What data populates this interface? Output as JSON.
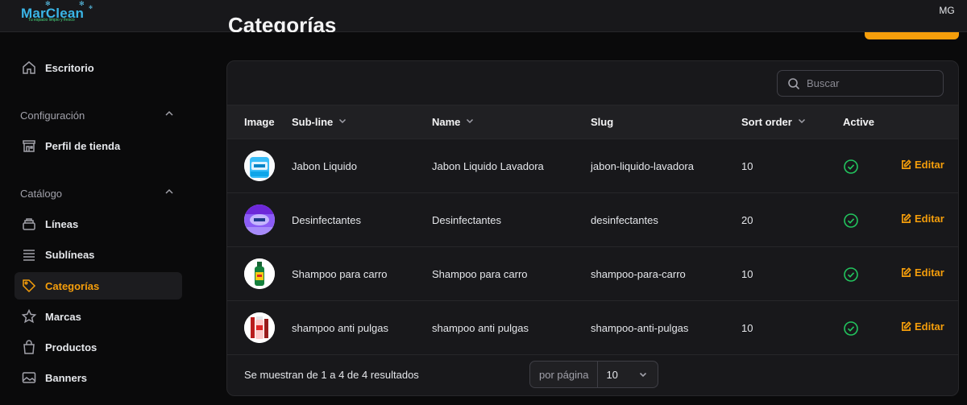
{
  "app": {
    "logo_text": "MarClean",
    "logo_tagline": "Tu espacio limpio y fresco",
    "user_initials": "MG"
  },
  "header": {
    "page_title": "Categorías"
  },
  "colors": {
    "accent": "#f59e0b",
    "active_check": "#22c55e",
    "logo": "#3ab5e6"
  },
  "sidebar": {
    "dashboard": {
      "label": "Escritorio",
      "icon": "home-icon"
    },
    "groups": [
      {
        "label": "Configuración",
        "items": [
          {
            "label": "Perfil de tienda",
            "icon": "store-icon"
          }
        ]
      },
      {
        "label": "Catálogo",
        "items": [
          {
            "label": "Líneas",
            "icon": "layers-icon"
          },
          {
            "label": "Sublíneas",
            "icon": "list-icon"
          },
          {
            "label": "Categorías",
            "icon": "tag-icon",
            "active": true
          },
          {
            "label": "Marcas",
            "icon": "star-icon"
          },
          {
            "label": "Productos",
            "icon": "shopping-bag-icon"
          },
          {
            "label": "Banners",
            "icon": "image-icon"
          }
        ]
      }
    ]
  },
  "table": {
    "search_placeholder": "Buscar",
    "columns": [
      "Image",
      "Sub-line",
      "Name",
      "Slug",
      "Sort order",
      "Active"
    ],
    "rows": [
      {
        "subline": "Jabon Liquido",
        "name": "Jabon Liquido Lavadora",
        "slug": "jabon-liquido-lavadora",
        "sort_order": "10",
        "active": true,
        "action": "Editar"
      },
      {
        "subline": "Desinfectantes",
        "name": "Desinfectantes",
        "slug": "desinfectantes",
        "sort_order": "20",
        "active": true,
        "action": "Editar"
      },
      {
        "subline": "Shampoo para carro",
        "name": "Shampoo para carro",
        "slug": "shampoo-para-carro",
        "sort_order": "10",
        "active": true,
        "action": "Editar"
      },
      {
        "subline": "shampoo anti pulgas",
        "name": "shampoo anti pulgas",
        "slug": "shampoo-anti-pulgas",
        "sort_order": "10",
        "active": true,
        "action": "Editar"
      }
    ],
    "footer": {
      "summary": "Se muestran de 1 a 4 de 4 resultados",
      "per_page_label": "por página",
      "per_page_value": "10"
    }
  }
}
